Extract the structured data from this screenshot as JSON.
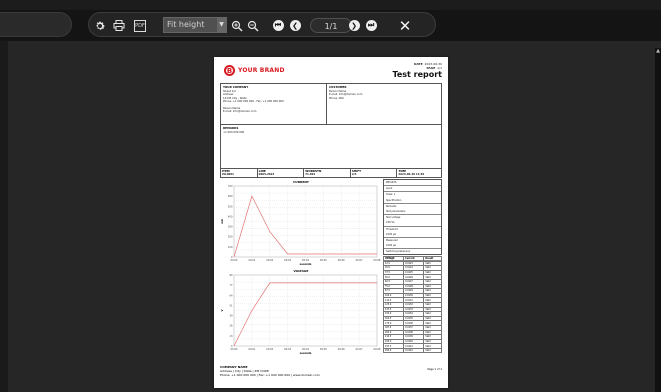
{
  "toolbar": {
    "zoom_select": "Fit height",
    "page_input": "1/1",
    "pdf_label": "PDF"
  },
  "report": {
    "brand": "YOUR BRAND",
    "title": "Test report",
    "date_label": "DATE",
    "date_value": "2023-06-30",
    "page_label": "PAGE",
    "page_value": "1/1",
    "your_company_label": "YOUR COMPANY",
    "company_lines": [
      "Street 1/2",
      "Address",
      "12345 City - State",
      "Phone: +1 000 000 000 - Fax: +1 000 000 000",
      "",
      "Person Name",
      "E-mail: info@domain.com"
    ],
    "customer_label": "CUSTOMER",
    "customer_lines": [
      "Person Name",
      "E-mail: info@domain.com",
      "Phone: 000"
    ],
    "remarks_label": "REMARKS",
    "remarks_lines": [
      "+1 000 000 000"
    ],
    "row": [
      {
        "label": "ITEM",
        "value": "ZX-0001"
      },
      {
        "label": "LINE",
        "value": "0005-2023"
      },
      {
        "label": "WORKSTN",
        "value": "T1.001"
      },
      {
        "label": "SHIFT",
        "value": "2/3"
      },
      {
        "label": "TIME",
        "value": "2023-06-30 11:30"
      }
    ],
    "chart_current_title": "CURRENT",
    "chart_voltage_title": "VOLTAGE",
    "x_axis_label": "seconds",
    "y_current_label": "mA",
    "y_voltage_label": "V",
    "side_labels": [
      "RESULTS",
      "Good",
      "Class: 1",
      "Specification",
      "Remarks",
      "Test parameters",
      "Test voltage",
      "230 VA",
      "Threshold",
      "1000 µA",
      "Measured",
      "1000 µA",
      "Switching behaviour",
      "500 µA"
    ],
    "table_header": [
      "Voltage",
      "Current",
      "Result"
    ],
    "table_rows": [
      [
        "12.5",
        "0.0123",
        "Valid"
      ],
      [
        "25.0",
        "0.0124",
        "Valid"
      ],
      [
        "37.5",
        "0.0125",
        "Valid"
      ],
      [
        "50.0",
        "0.0126",
        "Valid"
      ],
      [
        "62.5",
        "0.0127",
        "Valid"
      ],
      [
        "75.0",
        "0.0128",
        "Valid"
      ],
      [
        "87.5",
        "0.0129",
        "Valid"
      ],
      [
        "100.0",
        "0.0130",
        "Valid"
      ],
      [
        "112.5",
        "0.0131",
        "Valid"
      ],
      [
        "125.0",
        "0.0132",
        "Valid"
      ],
      [
        "137.5",
        "0.0133",
        "Valid"
      ],
      [
        "150.0",
        "0.0134",
        "Valid"
      ],
      [
        "162.5",
        "0.0135",
        "Valid"
      ],
      [
        "175.0",
        "0.0136",
        "Valid"
      ],
      [
        "187.5",
        "0.0137",
        "Valid"
      ],
      [
        "200.0",
        "0.0138",
        "Valid"
      ],
      [
        "212.5",
        "0.0139",
        "Valid"
      ],
      [
        "225.0",
        "0.0140",
        "Valid"
      ],
      [
        "237.5",
        "0.0141",
        "Valid"
      ],
      [
        "250.0",
        "0.0142",
        "Valid"
      ]
    ],
    "footer_company": "COMPANY NAME",
    "footer_line1": "Address | City | State | ZIP CODE",
    "footer_line2": "Phone: +1 000 000 000 | Fax: +1 000 000 000 | www.domain.com",
    "footer_page": "Page 1 of 1"
  },
  "chart_data": [
    {
      "type": "line",
      "title": "CURRENT",
      "xlabel": "seconds",
      "ylabel": "mA",
      "x": [
        0,
        1,
        2,
        3,
        4,
        5,
        6,
        7,
        8
      ],
      "series": [
        {
          "values": [
            0,
            600,
            250,
            30,
            30,
            30,
            30,
            30,
            30
          ]
        }
      ],
      "ylim": [
        0,
        700
      ]
    },
    {
      "type": "line",
      "title": "VOLTAGE",
      "xlabel": "seconds",
      "ylabel": "V",
      "x": [
        0,
        1,
        2,
        3,
        4,
        5,
        6,
        7,
        8
      ],
      "series": [
        {
          "values": [
            0,
            45,
            80,
            80,
            80,
            80,
            80,
            80,
            80
          ]
        }
      ],
      "ylim": [
        0,
        90
      ]
    }
  ]
}
